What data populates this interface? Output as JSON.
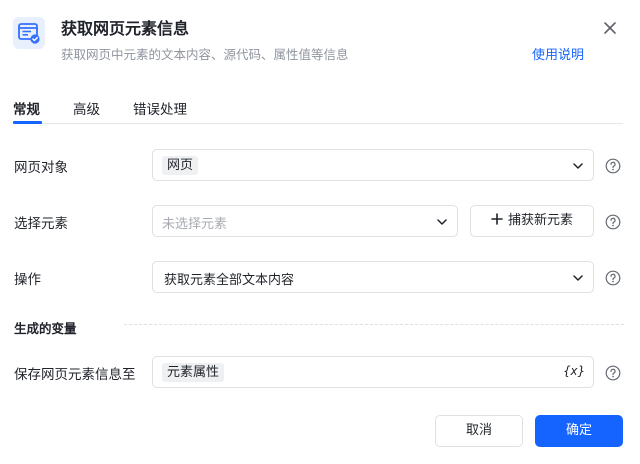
{
  "header": {
    "title": "获取网页元素信息",
    "subtitle": "获取网页中元素的文本内容、源代码、属性值等信息",
    "help_link": "使用说明",
    "icon": "browser-element-icon",
    "close_icon": "close-icon"
  },
  "tabs": [
    {
      "label": "常规",
      "active": true
    },
    {
      "label": "高级",
      "active": false
    },
    {
      "label": "错误处理",
      "active": false
    }
  ],
  "form": {
    "web_object": {
      "label": "网页对象",
      "value": "网页"
    },
    "select_element": {
      "label": "选择元素",
      "placeholder": "未选择元素",
      "capture_button": "捕获新元素"
    },
    "operation": {
      "label": "操作",
      "value": "获取元素全部文本内容"
    },
    "section_title": "生成的变量",
    "save_to": {
      "label": "保存网页元素信息至",
      "value": "元素属性",
      "var_icon": "{x}"
    }
  },
  "footer": {
    "cancel": "取消",
    "confirm": "确定"
  },
  "colors": {
    "accent": "#1664ff",
    "text": "#1f2329",
    "muted": "#8f959e",
    "border": "#dee0e3"
  }
}
